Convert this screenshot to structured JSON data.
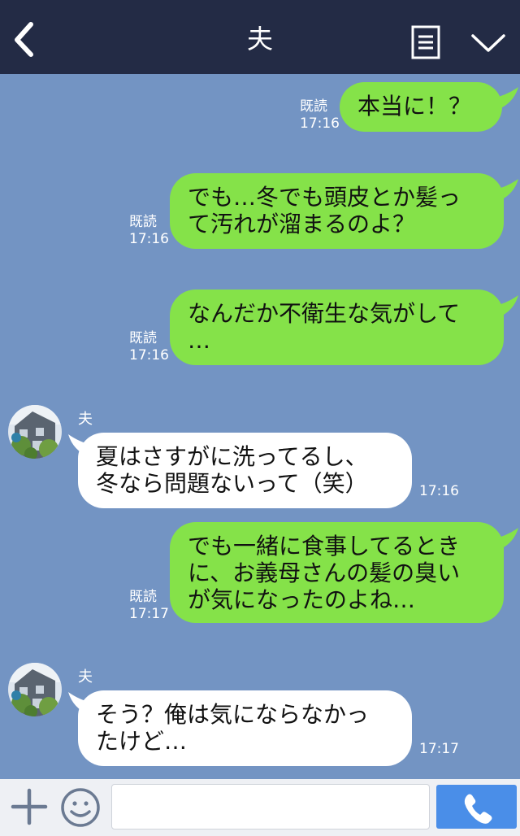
{
  "header": {
    "title": "夫",
    "icons": {
      "back": "chevron-left-icon",
      "menu": "menu-list-icon",
      "collapse": "chevron-down-icon"
    }
  },
  "messages": [
    {
      "from": "me",
      "text": "本当に！？",
      "read_label": "既読",
      "time": "17:16"
    },
    {
      "from": "me",
      "text": "でも…冬でも頭皮とか髪っ\nて汚れが溜まるのよ？",
      "read_label": "既読",
      "time": "17:16"
    },
    {
      "from": "me",
      "text": "なんだか不衛生な気がして\n…",
      "read_label": "既読",
      "time": "17:16"
    },
    {
      "from": "them",
      "sender": "夫",
      "text": "夏はさすがに洗ってるし、\n冬なら問題ないって（笑）",
      "time": "17:16"
    },
    {
      "from": "me",
      "text": "でも一緒に食事してるとき\nに、お義母さんの髪の臭い\nが気になったのよね…",
      "read_label": "既読",
      "time": "17:17"
    },
    {
      "from": "them",
      "sender": "夫",
      "text": "そう？俺は気にならなかっ\nたけど…",
      "time": "17:17"
    }
  ],
  "input_bar": {
    "placeholder": "",
    "icons": {
      "add": "plus-icon",
      "emoji": "smiley-icon",
      "call": "phone-icon"
    }
  },
  "colors": {
    "header_bg": "#232b45",
    "chat_bg": "#7394c3",
    "my_bubble": "#85e249",
    "their_bubble": "#ffffff",
    "call_button": "#4a8ee8"
  }
}
